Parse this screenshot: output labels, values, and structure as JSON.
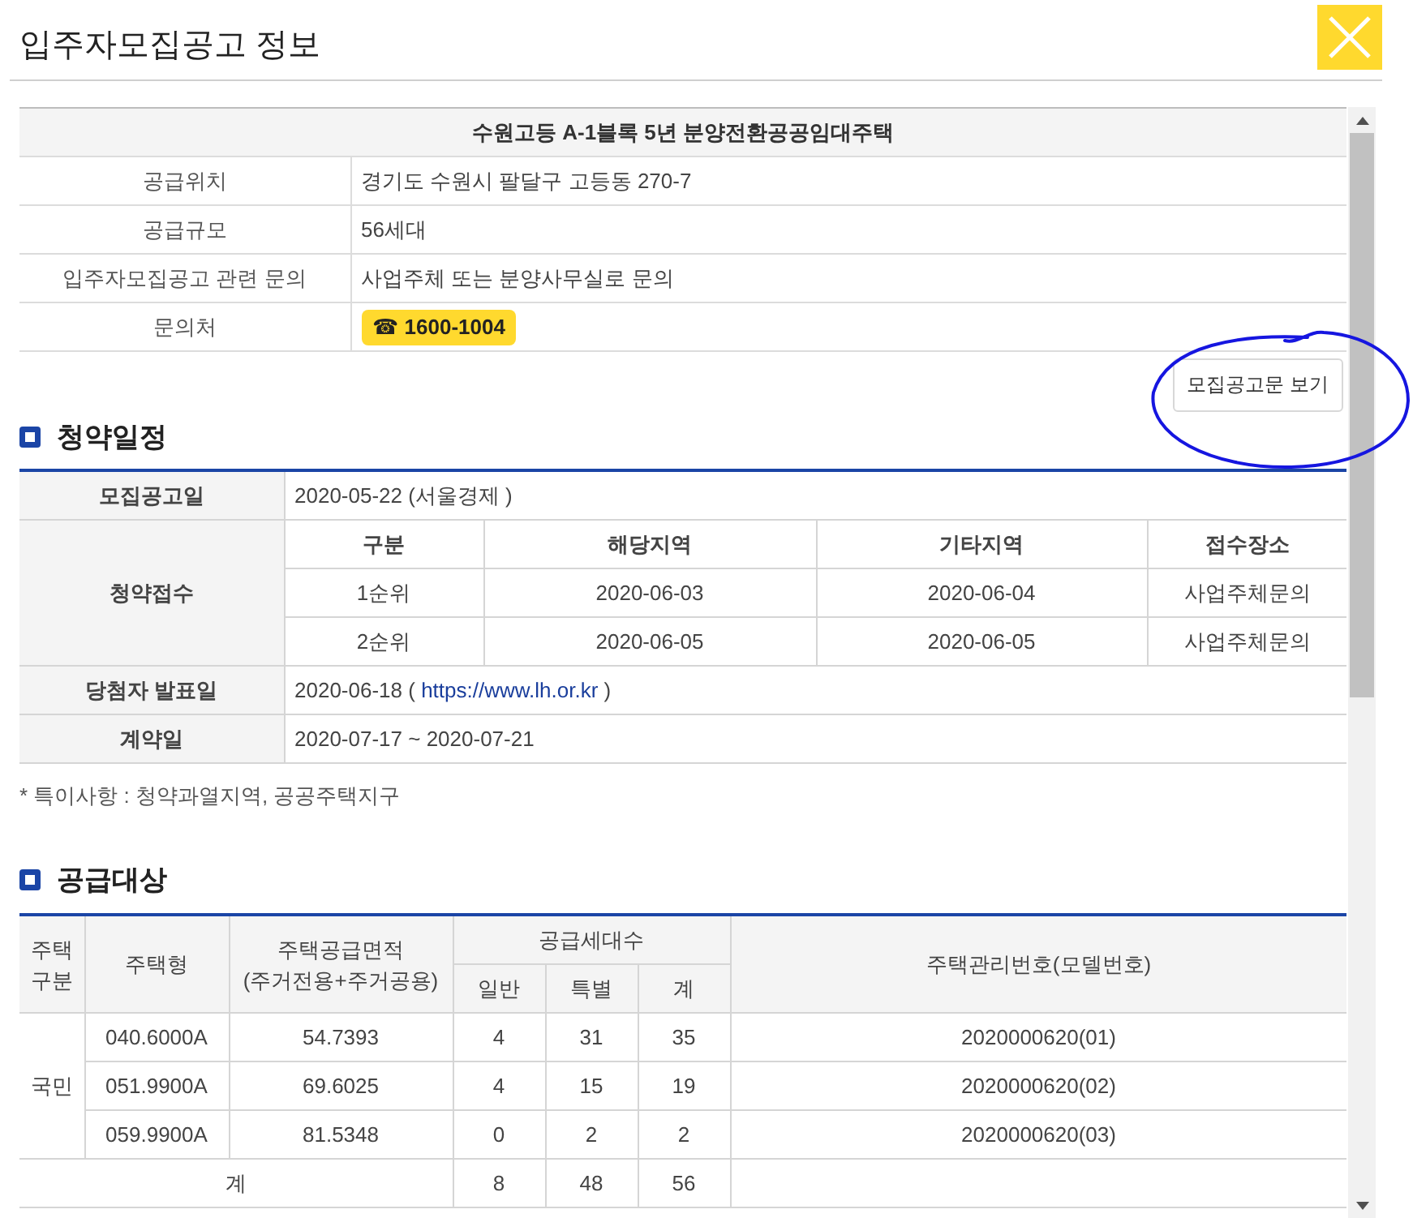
{
  "window": {
    "title": "입주자모집공고 정보"
  },
  "complex": {
    "name": "수원고등 A-1블록 5년 분양전환공공임대주택",
    "rows": [
      {
        "kind": "text",
        "label": "공급위치",
        "value": "경기도 수원시 팔달구 고등동 270-7"
      },
      {
        "kind": "text",
        "label": "공급규모",
        "value": "56세대"
      },
      {
        "kind": "text",
        "label": "입주자모집공고 관련 문의",
        "value": "사업주체 또는 분양사무실로 문의"
      },
      {
        "kind": "phone",
        "label": "문의처",
        "value": "☎ 1600-1004"
      }
    ]
  },
  "notice_button": {
    "label": "모집공고문 보기"
  },
  "annotations": [
    {
      "kind": "ellipse"
    }
  ],
  "schedule": {
    "title": "청약일정",
    "rows": [
      {
        "kind": "text",
        "label": "모집공고일",
        "value": "2020-05-22 (서울경제 )"
      },
      {
        "kind": "grid",
        "label": "청약접수",
        "columns": [
          "구분",
          "해당지역",
          "기타지역",
          "접수장소"
        ],
        "rows": [
          [
            "1순위",
            "2020-06-03",
            "2020-06-04",
            "사업주체문의"
          ],
          [
            "2순위",
            "2020-06-05",
            "2020-06-05",
            "사업주체문의"
          ]
        ]
      },
      {
        "kind": "link",
        "label": "당첨자 발표일",
        "before": "2020-06-18 ( ",
        "link": "https://www.lh.or.kr",
        "after": " )"
      },
      {
        "kind": "text",
        "label": "계약일",
        "value": "2020-07-17 ~ 2020-07-21"
      }
    ],
    "note": "* 특이사항 : 청약과열지역, 공공주택지구"
  },
  "supply": {
    "title": "공급대상",
    "header": {
      "type": "주택\n구분",
      "model": "주택형",
      "area": "주택공급면적\n(주거전용+주거공용)",
      "units": "공급세대수",
      "unit_columns": [
        "일반",
        "특별",
        "계"
      ],
      "number": "주택관리번호(모델번호)"
    },
    "groups": [
      {
        "type": "국민",
        "rows": [
          {
            "model": "040.6000A",
            "area": "54.7393",
            "units": [
              "4",
              "31",
              "35"
            ],
            "number": "2020000620(01)"
          },
          {
            "model": "051.9900A",
            "area": "69.6025",
            "units": [
              "4",
              "15",
              "19"
            ],
            "number": "2020000620(02)"
          },
          {
            "model": "059.9900A",
            "area": "81.5348",
            "units": [
              "0",
              "2",
              "2"
            ],
            "number": "2020000620(03)"
          }
        ]
      }
    ],
    "total": {
      "label": "계",
      "units": [
        "8",
        "48",
        "56"
      ]
    }
  }
}
